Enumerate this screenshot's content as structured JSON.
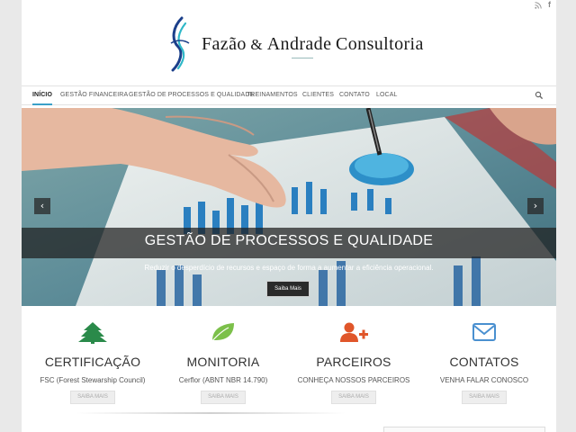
{
  "logo": {
    "name_part1": "Fazão",
    "ampersand": "&",
    "name_part2": "Andrade",
    "name_part3": "Consultoria"
  },
  "topbar": {
    "icons": [
      "rss-icon",
      "facebook-icon"
    ],
    "facebook_glyph": "f"
  },
  "nav": {
    "items": [
      {
        "label": "INÍCIO",
        "active": true
      },
      {
        "label": "GESTÃO FINANCEIRA",
        "active": false
      },
      {
        "label": "GESTÃO DE PROCESSOS E QUALIDADE",
        "active": false
      },
      {
        "label": "TREINAMENTOS",
        "active": false
      },
      {
        "label": "CLIENTES",
        "active": false
      },
      {
        "label": "CONTATO",
        "active": false
      },
      {
        "label": "LOCAL",
        "active": false
      }
    ],
    "search_icon": "search-icon",
    "active_color": "#3aa0c8"
  },
  "slider": {
    "title": "GESTÃO DE PROCESSOS E QUALIDADE",
    "description": "Reduzir o desperdício de recursos e espaço de forma a aumentar a eficiência operacional.",
    "button_label": "Saiba Mais",
    "prev_glyph": "‹",
    "next_glyph": "›"
  },
  "features": [
    {
      "icon": "tree-icon",
      "color": "#2a8a4a",
      "title": "CERTIFICAÇÃO",
      "subtitle": "FSC (Forest Stewarship Council)",
      "button_label": "SAIBA MAIS"
    },
    {
      "icon": "leaf-icon",
      "color": "#7cc04a",
      "title": "MONITORIA",
      "subtitle": "Cerflor (ABNT NBR 14.790)",
      "button_label": "SAIBA MAIS"
    },
    {
      "icon": "add-user-icon",
      "color": "#e0562a",
      "title": "PARCEIROS",
      "subtitle": "CONHEÇA NOSSOS PARCEIROS",
      "button_label": "SAIBA MAIS"
    },
    {
      "icon": "envelope-icon",
      "color": "#4a90d0",
      "title": "CONTATOS",
      "subtitle": "VENHA FALAR CONOSCO",
      "button_label": "SAIBA MAIS"
    }
  ]
}
